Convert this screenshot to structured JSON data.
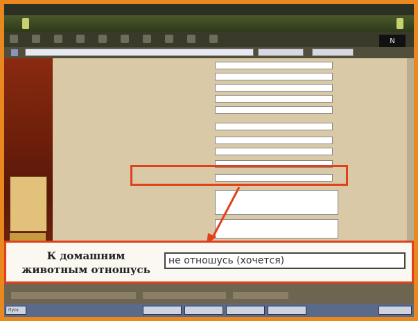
{
  "window": {
    "title": "",
    "logo_text": "N"
  },
  "address": {
    "url": "",
    "search_label": "",
    "engine_label": ""
  },
  "sidebar": {
    "items": [
      {
        "label": ""
      },
      {
        "label": ""
      },
      {
        "label": ""
      },
      {
        "label": ""
      },
      {
        "label": ""
      },
      {
        "label": ""
      },
      {
        "label": ""
      },
      {
        "label": ""
      },
      {
        "label": ""
      }
    ]
  },
  "form": {
    "rows": [
      {
        "label": "",
        "value": ""
      },
      {
        "label": "",
        "value": ""
      },
      {
        "label": "",
        "value": ""
      },
      {
        "label": "",
        "value": ""
      },
      {
        "label": "",
        "value": ""
      },
      {
        "label": "",
        "value": ""
      },
      {
        "label": "",
        "value": ""
      },
      {
        "label": "",
        "value": ""
      },
      {
        "label": "",
        "value": ""
      }
    ],
    "highlight_row": {
      "label": "",
      "value": ""
    },
    "textarea_1_label": "",
    "textarea_2_label": ""
  },
  "callout": {
    "label": "К домашним животным отношусь",
    "value": "не отношусь (хочется)"
  },
  "taskbar": {
    "start_label": "Пуск",
    "buttons": [
      "",
      "",
      "",
      ""
    ],
    "clock": ""
  },
  "colors": {
    "frame": "#e8881e",
    "highlight": "#e0401a"
  }
}
